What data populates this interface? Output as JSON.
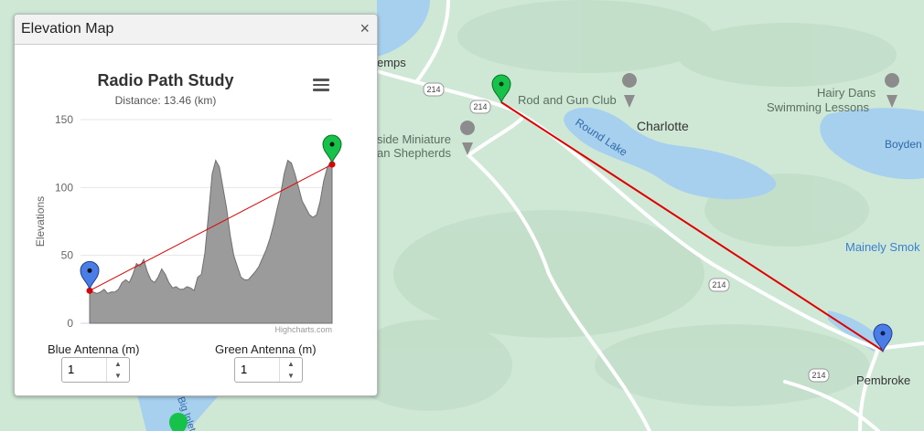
{
  "map": {
    "labels": [
      {
        "text": "emps",
        "kind": "place"
      },
      {
        "text": "Rod and Gun Club",
        "kind": "poi"
      },
      {
        "text": "Charlotte",
        "kind": "place"
      },
      {
        "text": "Round Lake",
        "kind": "water"
      },
      {
        "text": "Hairy Dans",
        "kind": "poi"
      },
      {
        "text": "Swimming Lessons",
        "kind": "poi"
      },
      {
        "text": "Boyden",
        "kind": "water"
      },
      {
        "text": "side Miniature",
        "kind": "poi"
      },
      {
        "text": "an Shepherds",
        "kind": "poi"
      },
      {
        "text": "Mainely Smok",
        "kind": "blue"
      },
      {
        "text": "Pembroke",
        "kind": "place"
      },
      {
        "text": "Big Inlet",
        "kind": "water"
      }
    ],
    "route_shields": [
      "214",
      "214",
      "214",
      "214"
    ],
    "colors": {
      "land": "#cfe8d6",
      "water": "#a7d0ef",
      "road": "#ffffff",
      "path_line": "#e00000"
    }
  },
  "panel": {
    "title": "Elevation Map",
    "close_glyph": "×"
  },
  "chart_data": {
    "type": "area",
    "title": "Radio Path Study",
    "subtitle": "Distance: 13.46 (km)",
    "ylabel": "Elevations",
    "xlabel": "",
    "ylim": [
      0,
      150
    ],
    "yticks": [
      0,
      50,
      100,
      150
    ],
    "credits": "Highcharts.com",
    "grid": true,
    "legend": "none",
    "x": [
      0,
      0.2,
      0.4,
      0.6,
      0.8,
      1.0,
      1.2,
      1.4,
      1.6,
      1.8,
      2.0,
      2.2,
      2.4,
      2.6,
      2.8,
      3.0,
      3.2,
      3.4,
      3.6,
      3.8,
      4.0,
      4.2,
      4.4,
      4.6,
      4.8,
      5.0,
      5.2,
      5.4,
      5.6,
      5.8,
      6.0,
      6.2,
      6.4,
      6.6,
      6.8,
      7.0,
      7.2,
      7.4,
      7.6,
      7.8,
      8.0,
      8.2,
      8.4,
      8.6,
      8.8,
      9.0,
      9.2,
      9.4,
      9.6,
      9.8,
      10.0,
      10.2,
      10.4,
      10.6,
      10.8,
      11.0,
      11.2,
      11.4,
      11.6,
      11.8,
      12.0,
      12.2,
      12.4,
      12.6,
      12.8,
      13.0,
      13.2,
      13.46
    ],
    "elevation": [
      26,
      23,
      22,
      23,
      25,
      22,
      23,
      23,
      25,
      30,
      32,
      30,
      36,
      44,
      42,
      47,
      38,
      32,
      30,
      34,
      40,
      36,
      30,
      26,
      27,
      25,
      25,
      27,
      26,
      24,
      34,
      36,
      52,
      80,
      110,
      120,
      115,
      100,
      85,
      65,
      50,
      42,
      34,
      32,
      32,
      35,
      38,
      42,
      48,
      54,
      62,
      72,
      84,
      95,
      110,
      120,
      118,
      110,
      100,
      90,
      85,
      80,
      78,
      80,
      90,
      105,
      115,
      120
    ],
    "line_of_sight": {
      "start": 24,
      "end": 117
    },
    "markers": [
      {
        "name": "blue",
        "color": "#4a7de8"
      },
      {
        "name": "green",
        "color": "#17c24a"
      }
    ]
  },
  "antennas": {
    "blue_label": "Blue Antenna (m)",
    "blue_value": "1",
    "green_label": "Green Antenna (m)",
    "green_value": "1",
    "up_glyph": "▲",
    "down_glyph": "▼"
  }
}
